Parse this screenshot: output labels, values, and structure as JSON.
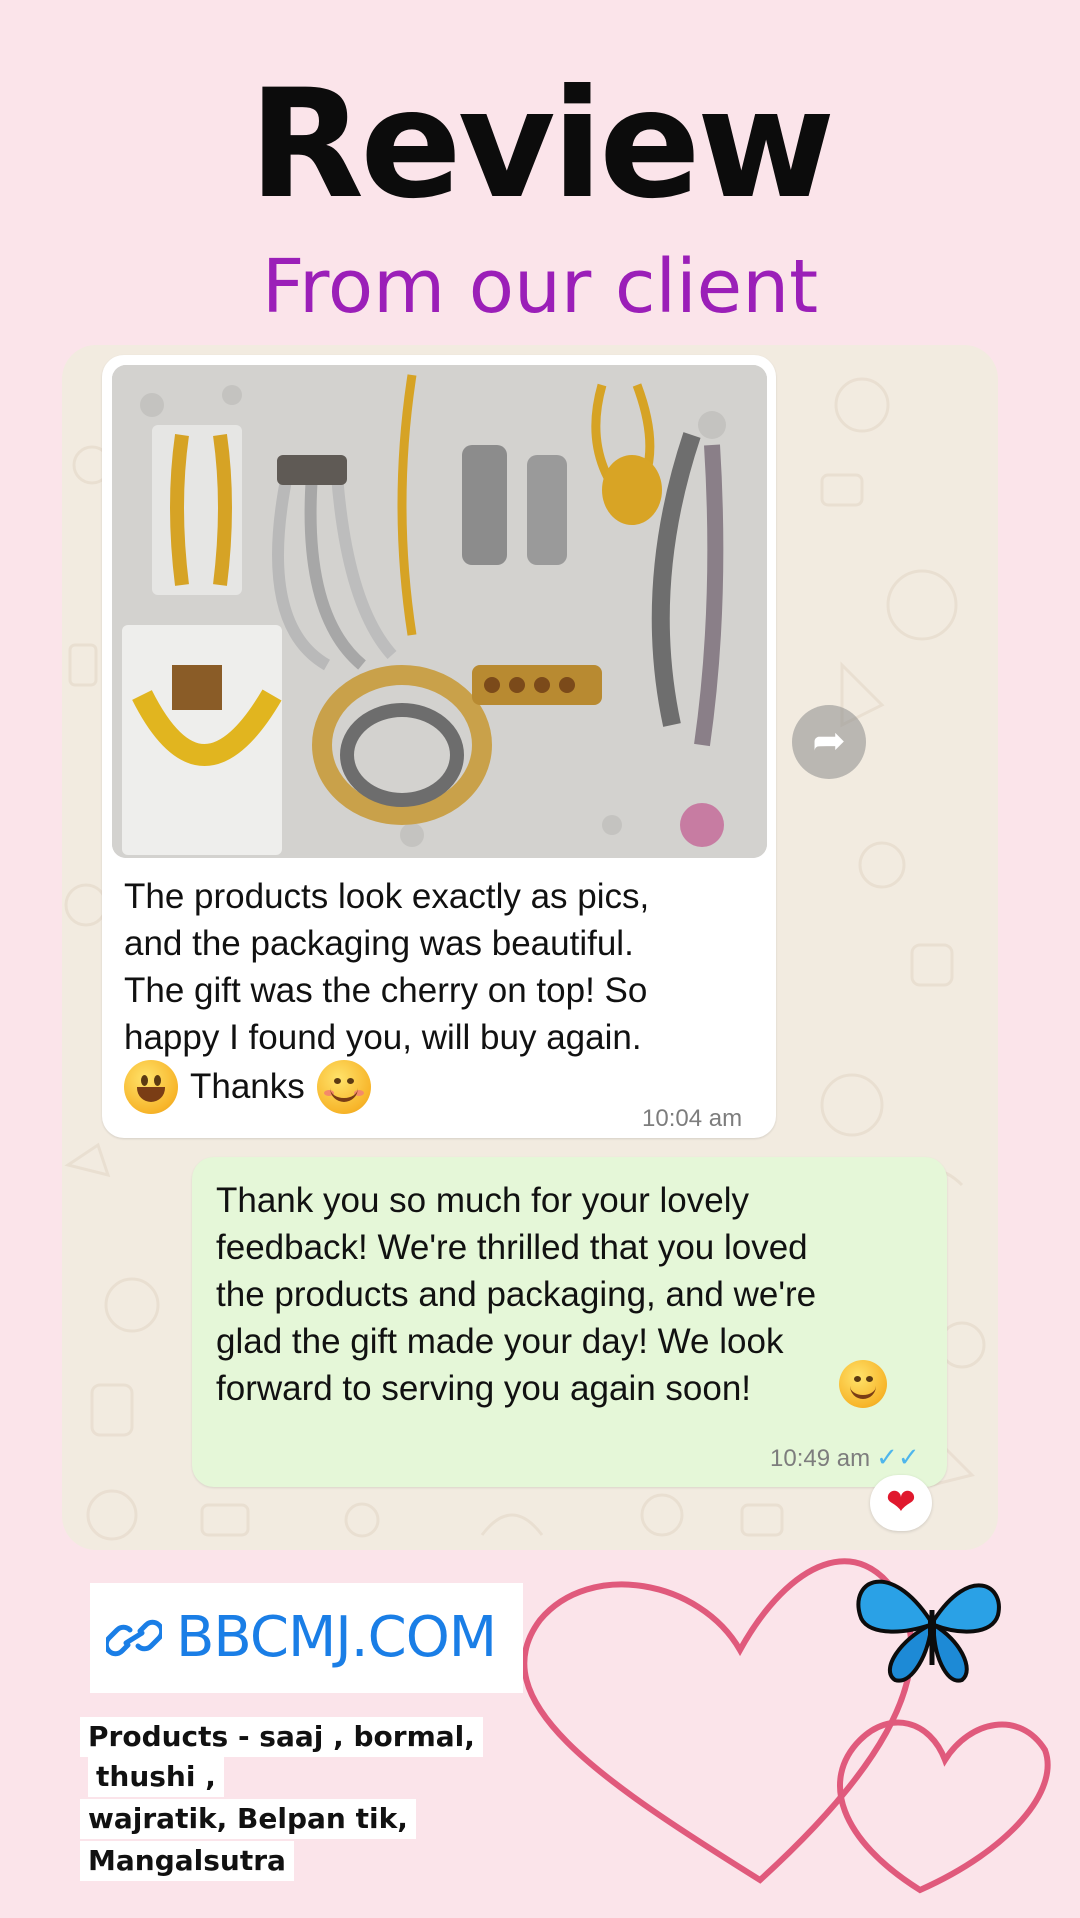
{
  "header": {
    "title": "Review",
    "subtitle": "From our client"
  },
  "chat": {
    "incoming": {
      "text": "The products look exactly as pics,\nand the packaging was beautiful.\nThe gift was the cherry on top! So\nhappy I found you, will buy again.",
      "thanks": "Thanks",
      "time": "10:04 am",
      "image_subject": "jewellery-products-photo"
    },
    "outgoing": {
      "text": "Thank you so much for your lovely\nfeedback! We're thrilled that you loved\nthe products and packaging, and we're\nglad the gift made your day! We look\nforward to serving you again soon!",
      "time": "10:49 am",
      "read_ticks": "✓✓"
    },
    "reaction": "❤",
    "forward_icon": "forward-icon"
  },
  "promo": {
    "link_text": "BBCMJ.COM",
    "products_lines": [
      "Products - saaj , bormal,",
      "thushi ,",
      "wajratik, Belpan tik,",
      "Mangalsutra"
    ]
  },
  "colors": {
    "background": "#fbe4ea",
    "subtitle": "#9b1fb8",
    "incoming_bubble": "#ffffff",
    "outgoing_bubble": "#e5f7d8",
    "link": "#1a7ee6",
    "hearts": "#e05a7c"
  }
}
